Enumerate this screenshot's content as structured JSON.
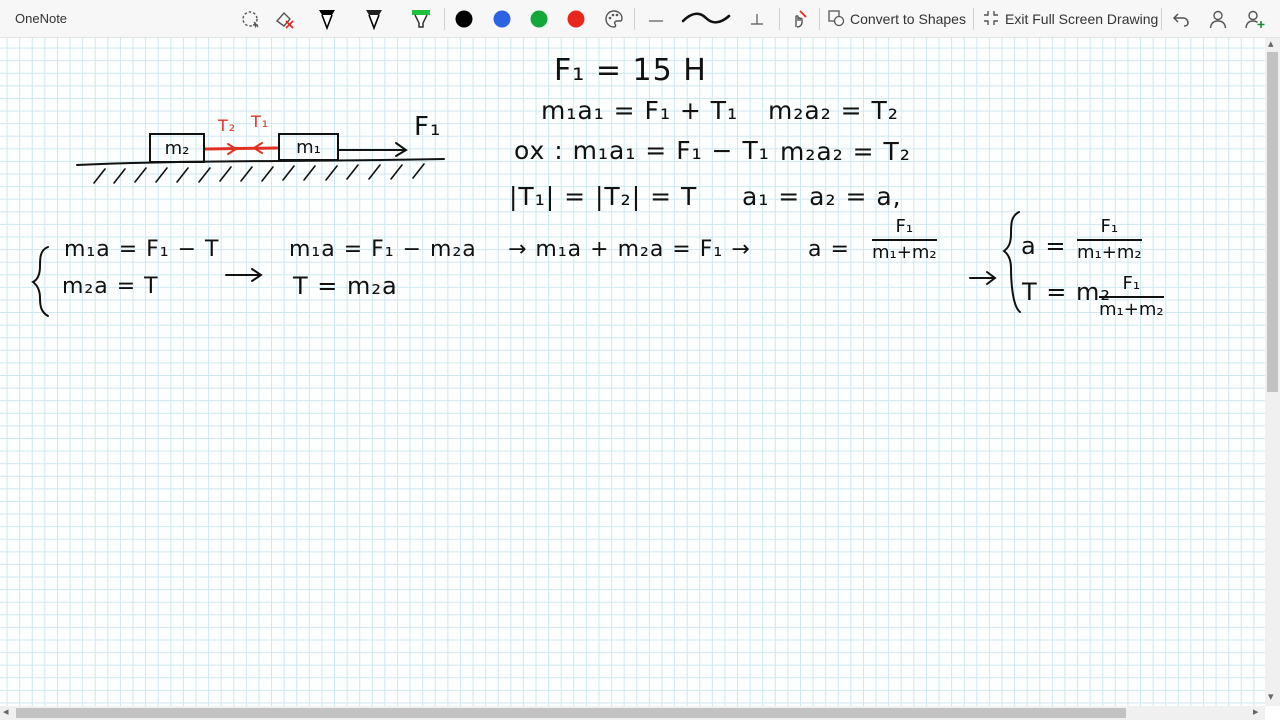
{
  "app": {
    "title": "OneNote"
  },
  "toolbar": {
    "tools": [
      {
        "name": "lasso-select-icon"
      },
      {
        "name": "eraser-icon"
      },
      {
        "name": "pen-black-icon"
      },
      {
        "name": "pen-dark-icon"
      },
      {
        "name": "highlighter-green-icon"
      }
    ],
    "colors": [
      "#000000",
      "#2b63e0",
      "#14a83a",
      "#e8271c"
    ],
    "convert_label": "Convert to Shapes",
    "exit_label": "Exit Full Screen Drawing"
  },
  "note": {
    "f1_def": "F₁ = 15 H",
    "eq1_left": "m₁a₁ = F₁ + T₁",
    "eq1_right": "m₂a₂ = T₂",
    "eq2_left": "ox : m₁a₁ = F₁ − T₁",
    "eq2_right": "m₂a₂ = T₂",
    "eq3_left": "|T₁| = |T₂| = T",
    "eq3_right": "a₁ = a₂ = a,",
    "diagram": {
      "block_m2": "m₂",
      "block_m1": "m₁",
      "label_t2": "T₂",
      "label_t1": "T₁",
      "label_f1": "F₁"
    },
    "system_left": [
      "m₁a = F₁ − T",
      "m₂a = T"
    ],
    "sub1": "m₁a = F₁ − m₂a",
    "sub2": "T = m₂a",
    "chain1": "→ m₁a + m₂a = F₁ →",
    "a_eq": "a =",
    "frac1": {
      "num": "F₁",
      "den": "m₁+m₂"
    },
    "result_a": "a =",
    "result_frac_a": {
      "num": "F₁",
      "den": "m₁+m₂"
    },
    "result_t": "T = m₂",
    "result_frac_t": {
      "num": "F₁",
      "den": "m₁+m₂"
    }
  }
}
